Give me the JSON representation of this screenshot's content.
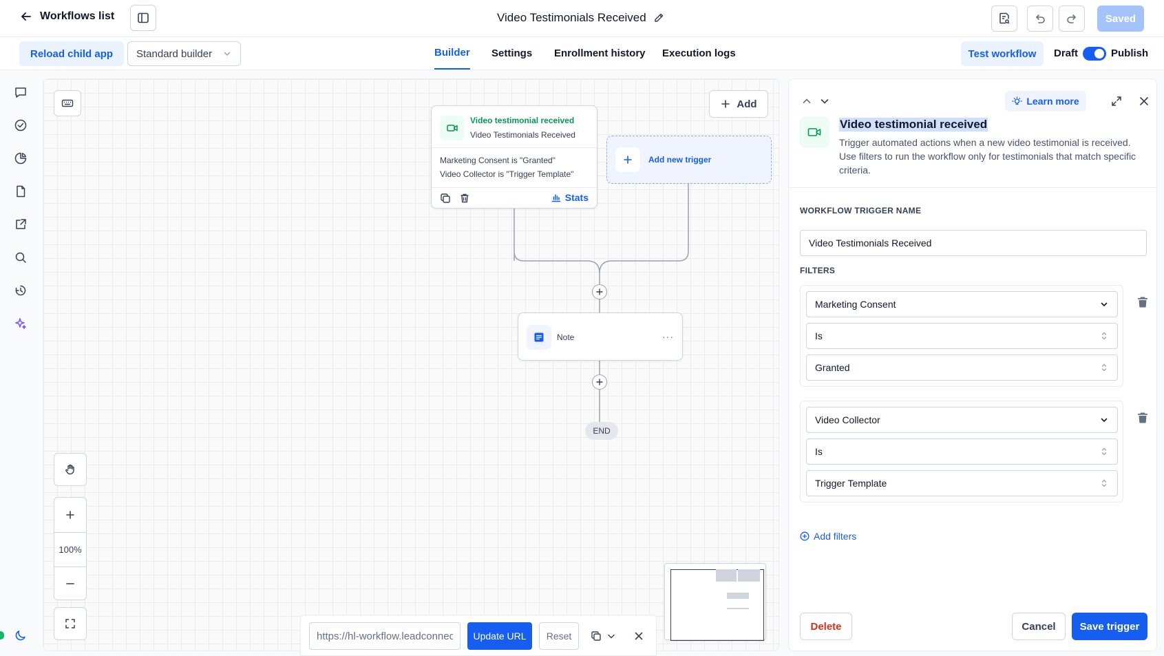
{
  "header": {
    "back_label": "Workflows list",
    "title": "Video Testimonials Received",
    "saved_label": "Saved"
  },
  "subbar": {
    "reload_label": "Reload child app",
    "builder_select": "Standard builder",
    "tabs": [
      {
        "label": "Builder"
      },
      {
        "label": "Settings"
      },
      {
        "label": "Enrollment history"
      },
      {
        "label": "Execution logs"
      }
    ],
    "test_label": "Test workflow",
    "draft_label": "Draft",
    "publish_label": "Publish"
  },
  "canvas": {
    "add_label": "Add",
    "trigger": {
      "type_label": "Video testimonial received",
      "name": "Video Testimonials Received",
      "filters": [
        "Marketing Consent is \"Granted\"",
        "Video Collector is \"Trigger Template\""
      ],
      "stats_label": "Stats"
    },
    "new_trigger_label": "Add new trigger",
    "note_label": "Note",
    "note_more": "···",
    "end_label": "END",
    "zoom_label": "100%"
  },
  "url_bar": {
    "value": "https://hl-workflow.leadconnectorhq.com",
    "update_label": "Update URL",
    "reset_label": "Reset"
  },
  "panel": {
    "learn_more": "Learn more",
    "title": "Video testimonial received",
    "description": "Trigger automated actions when a new video testimonial is received. Use filters to run the workflow only for testimonials that match specific criteria.",
    "trigger_name_label": "WORKFLOW TRIGGER NAME",
    "trigger_name_value": "Video Testimonials Received",
    "filters_label": "FILTERS",
    "filters": [
      {
        "field": "Marketing Consent",
        "operator": "Is",
        "value": "Granted"
      },
      {
        "field": "Video Collector",
        "operator": "Is",
        "value": "Trigger Template"
      }
    ],
    "add_filters_label": "Add filters",
    "delete_label": "Delete",
    "cancel_label": "Cancel",
    "save_label": "Save trigger"
  },
  "colors": {
    "accent": "#155eef",
    "trigger_green": "#039855",
    "danger": "#d92d20"
  }
}
